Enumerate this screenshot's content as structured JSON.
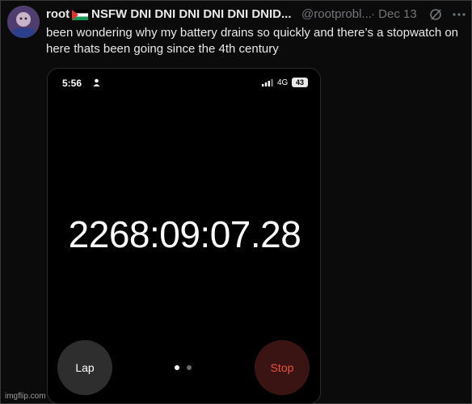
{
  "tweet": {
    "author_name": "root",
    "author_title": "NSFW DNI DNI DNI DNI DNI DNID...",
    "handle": "@rootprobl...",
    "date": "· Dec 13",
    "text": "been wondering why my battery drains so quickly and there’s a stopwatch on here thats been going since the 4th century"
  },
  "phone": {
    "time": "5:56",
    "network": "4G",
    "battery": "43",
    "stopwatch": "2268:09:07.28",
    "lap_label": "Lap",
    "stop_label": "Stop"
  },
  "watermark": "imgflip.com",
  "icons": [
    "avatar",
    "palestine-flag-icon",
    "grok-icon",
    "more-icon",
    "person-icon",
    "signal-icon"
  ]
}
